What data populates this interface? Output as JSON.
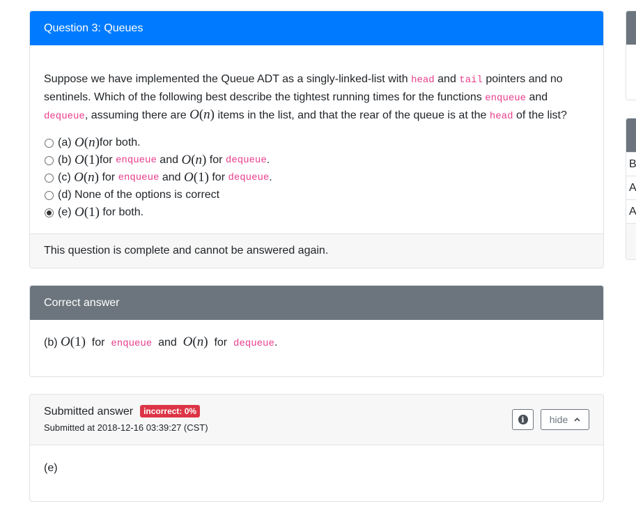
{
  "question_card": {
    "title": "Question 3: Queues",
    "prompt": {
      "p1": "Suppose we have implemented the Queue ADT as a singly-linked-list with ",
      "code_head": "head",
      "p2": " and ",
      "code_tail": "tail",
      "p3": " pointers and no sentinels. Which of the following best describe the tightest running times for the functions ",
      "code_enqueue": "enqueue",
      "p4": " and ",
      "code_dequeue": "dequeue",
      "p5": ", assuming there are ",
      "math_On": "O(n)",
      "p6": " items in the list, and that the rear of the queue is at the ",
      "code_head2": "head",
      "p7": " of the list?"
    },
    "options": [
      {
        "prefix": "(a) ",
        "math1": "O(n)",
        "text": " for both.",
        "selected": false
      },
      {
        "prefix": "(b) ",
        "math1": "O(1)",
        "t1": " for ",
        "c1": "enqueue",
        "t2": " and ",
        "math2": "O(n)",
        "t3": " for ",
        "c2": "dequeue",
        "t4": ".",
        "selected": false
      },
      {
        "prefix": "(c) ",
        "math1": "O(n)",
        "t1": " for ",
        "c1": "enqueue",
        "t2": " and ",
        "math2": "O(1)",
        "t3": " for ",
        "c2": "dequeue",
        "t4": ".",
        "selected": false
      },
      {
        "prefix": "(d) ",
        "text": "None of the options is correct",
        "selected": false
      },
      {
        "prefix": "(e) ",
        "math1": "O(1)",
        "text": " for both.",
        "selected": true
      }
    ],
    "footer": "This question is complete and cannot be answered again."
  },
  "correct_card": {
    "title": "Correct answer",
    "answer": {
      "prefix": "(b) ",
      "math1": "O(1)",
      "t1": " for ",
      "c1": "enqueue",
      "t2": " and ",
      "math2": "O(n)",
      "t3": " for ",
      "c2": "dequeue",
      "t4": "."
    }
  },
  "submitted_card": {
    "title": "Submitted answer",
    "badge": "incorrect: 0%",
    "timestamp": "Submitted at 2018-12-16 03:39:27 (CST)",
    "info_icon_glyph": "i",
    "hide_label": "hide",
    "hide_chevron": "⌃",
    "answer": "(e)"
  },
  "side_panel": {
    "rows": [
      "B",
      "A",
      "A"
    ]
  },
  "colors": {
    "primary": "#007bff",
    "secondary": "#6c757d",
    "danger": "#dc3545",
    "code": "#e83e8c"
  }
}
